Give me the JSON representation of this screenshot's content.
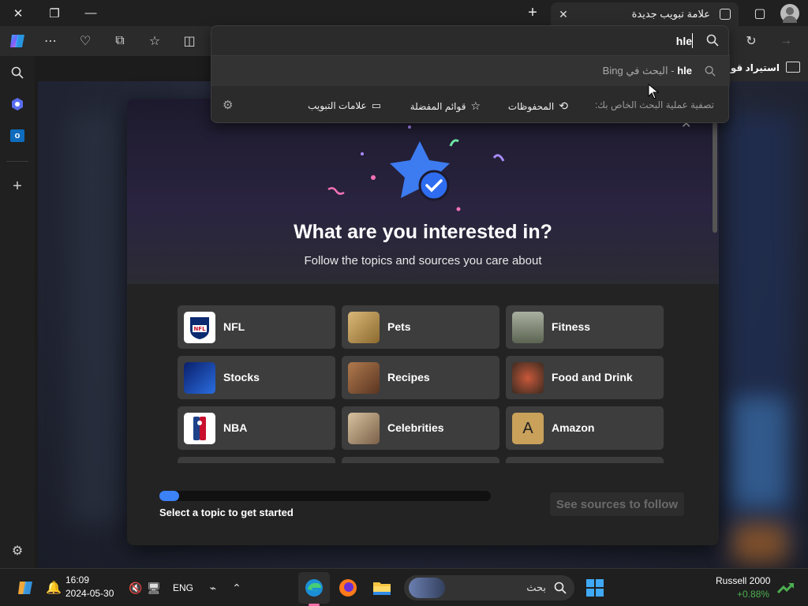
{
  "window": {
    "tab_title": "علامة تبويب جديدة"
  },
  "address": {
    "value": "hle",
    "suggestion_query": "hle",
    "suggestion_suffix": "- البحث في Bing",
    "filter_label": "تصفية عملية البحث الخاص بك:",
    "filters": [
      {
        "label": "المحفوظات",
        "icon": "history-icon"
      },
      {
        "label": "قوائم المفضلة",
        "icon": "star-icon"
      },
      {
        "label": "علامات التبويب",
        "icon": "tabs-icon"
      }
    ]
  },
  "favorites_bar": {
    "import_label": "استيراد قوائ"
  },
  "dialog": {
    "title": "What are you interested in?",
    "subtitle": "Follow the topics and sources you care about",
    "topics": [
      {
        "name": "NFL",
        "thumb": "NFL",
        "color": "#ffffff"
      },
      {
        "name": "Pets",
        "thumb": "",
        "color": "#c8a25a"
      },
      {
        "name": "Fitness",
        "thumb": "",
        "color": "#8a8f7a"
      },
      {
        "name": "Stocks",
        "thumb": "",
        "color": "#1a3fa8"
      },
      {
        "name": "Recipes",
        "thumb": "",
        "color": "#8b5a3c"
      },
      {
        "name": "Food and Drink",
        "thumb": "",
        "color": "#5c3a2a"
      },
      {
        "name": "NBA",
        "thumb": "NBA",
        "color": "#ffffff"
      },
      {
        "name": "Celebrities",
        "thumb": "",
        "color": "#b59a78"
      },
      {
        "name": "Amazon",
        "thumb": "A",
        "color": "#c9a15a"
      }
    ],
    "progress": 0.06,
    "progress_label": "Select a topic to get started",
    "next_button": "See sources to follow"
  },
  "taskbar": {
    "time": "16:09",
    "date": "2024-05-30",
    "language": "ENG",
    "search_placeholder": "بحث",
    "widget_title": "Russell 2000",
    "widget_value": "+0.88%"
  },
  "colors": {
    "accent": "#3b82f6",
    "widget_green": "#4caf50"
  }
}
